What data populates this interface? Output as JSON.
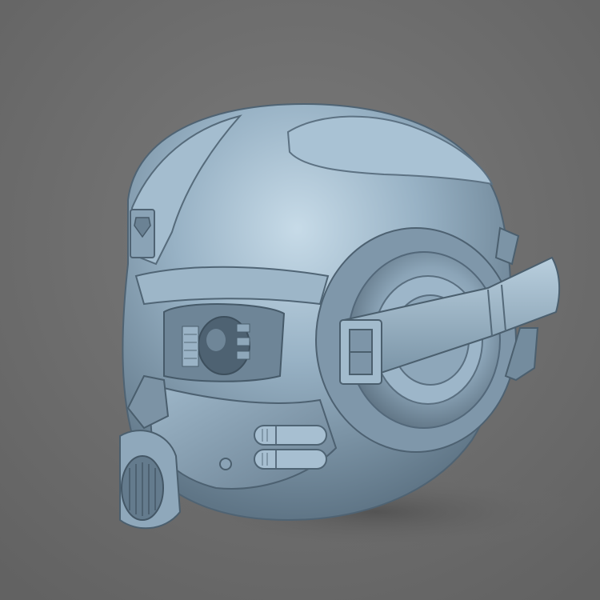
{
  "image": {
    "subject": "3d-helmet-render",
    "background_color": "#6f6f6f",
    "material_color": "#8fa9bd",
    "icons": [
      "insignia-icon"
    ]
  }
}
